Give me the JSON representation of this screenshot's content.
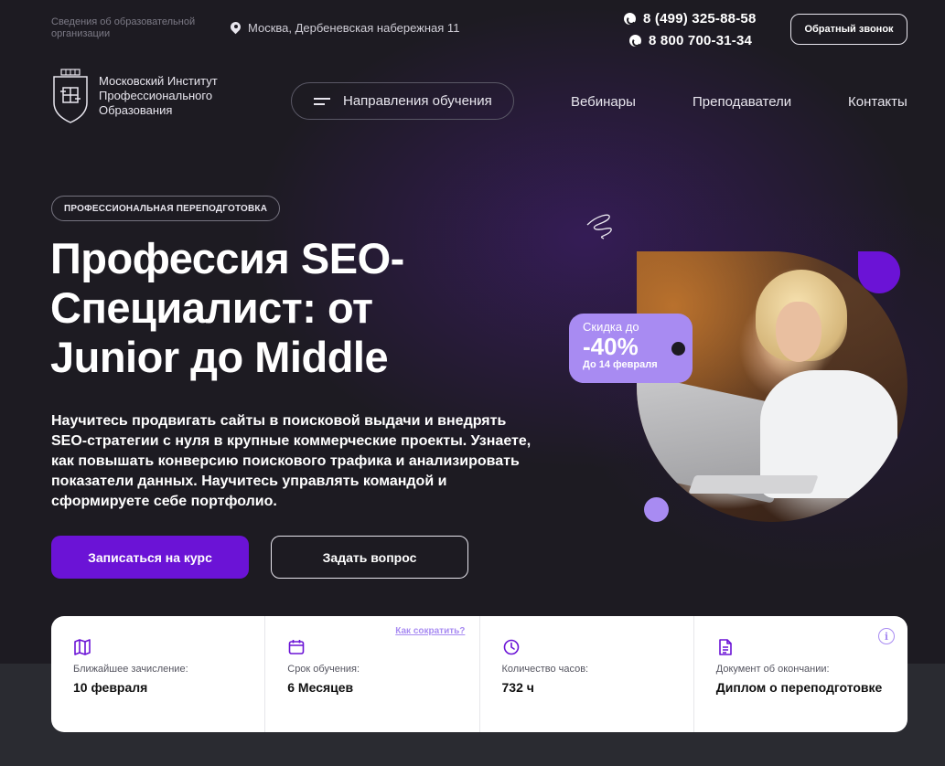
{
  "header": {
    "edu_info": "Сведения об образовательной организации",
    "address": "Москва, Дербеневская набережная 11",
    "phone1": "8 (499) 325-88-58",
    "phone2": "8 800 700-31-34",
    "callback_label": "Обратный звонок"
  },
  "nav": {
    "logo_text": "Московский Институт Профессионального Образования",
    "directions_label": "Направления обучения",
    "links": [
      "Вебинары",
      "Преподаватели",
      "Контакты"
    ]
  },
  "hero": {
    "badge": "ПРОФЕССИОНАЛЬНАЯ ПЕРЕПОДГОТОВКА",
    "title": "Профессия SEO-Специалист: от Junior до Middle",
    "description": "Научитесь продвигать сайты в поисковой выдачи и внедрять SEO-стратегии с нуля в крупные коммерческие проекты. Узнаете, как повышать конверсию поискового трафика и анализировать показатели данных. Научитесь управлять командой и сформируете себе портфолио.",
    "primary_button": "Записаться на курс",
    "secondary_button": "Задать вопрос"
  },
  "discount": {
    "line1": "Скидка до",
    "value": "-40%",
    "until": "До 14 февраля"
  },
  "info": {
    "shorten_link": "Как сократить?",
    "items": [
      {
        "icon": "map-icon",
        "label": "Ближайшее зачисление:",
        "value": "10 февраля"
      },
      {
        "icon": "calendar-icon",
        "label": "Срок обучения:",
        "value": "6 Месяцев"
      },
      {
        "icon": "clock-icon",
        "label": "Количество часов:",
        "value": "732 ч"
      },
      {
        "icon": "document-icon",
        "label": "Документ об окончании:",
        "value": "Диплом о переподготовке"
      }
    ]
  },
  "colors": {
    "accent": "#6b13d6",
    "lilac": "#a88bf2",
    "background": "#1d1b22"
  }
}
